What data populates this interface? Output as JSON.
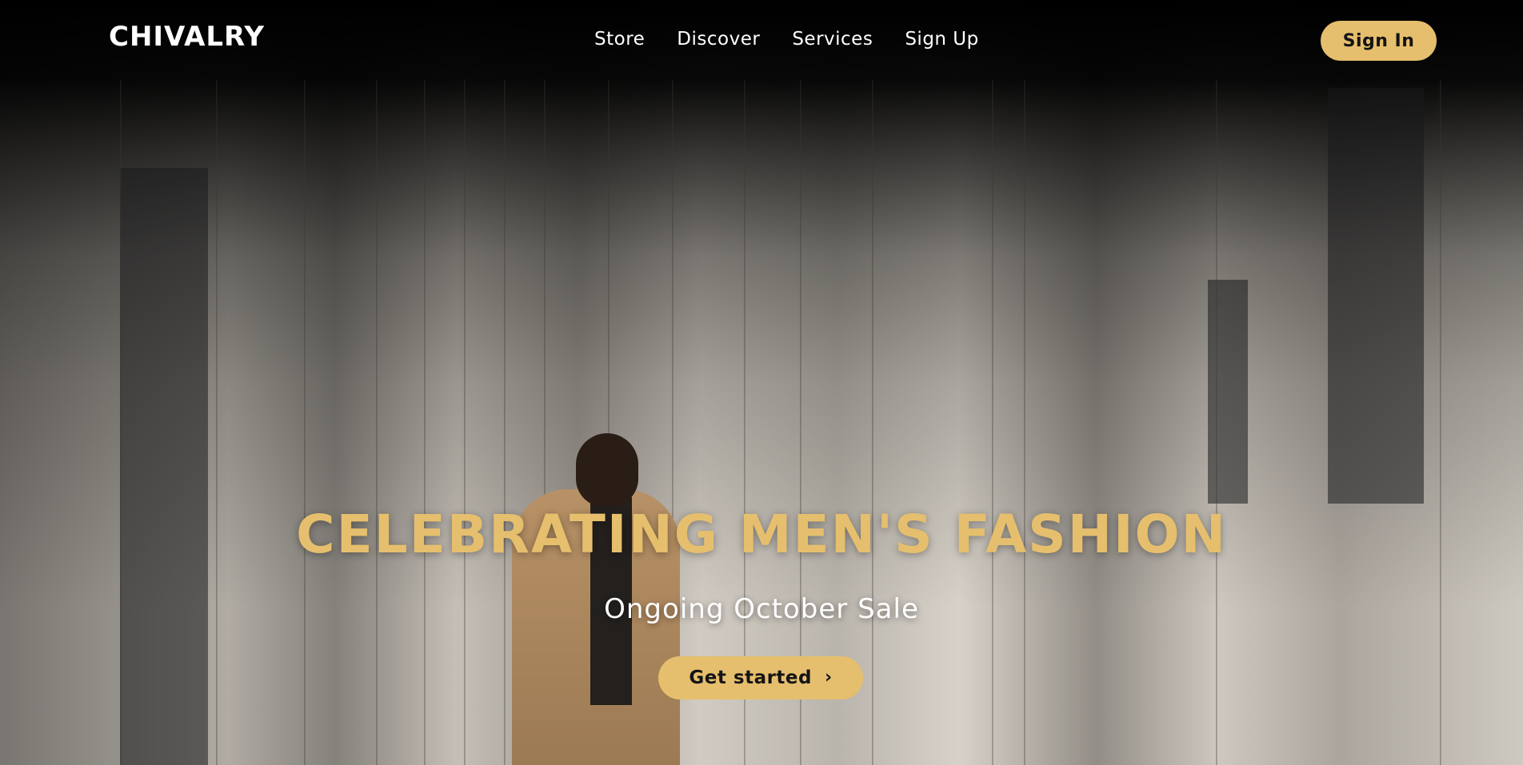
{
  "brand": {
    "logo_text": "CHIVALRY"
  },
  "nav": {
    "items": [
      {
        "label": "Store"
      },
      {
        "label": "Discover"
      },
      {
        "label": "Services"
      },
      {
        "label": "Sign Up"
      }
    ],
    "signin_label": "Sign In"
  },
  "hero": {
    "headline": "CELEBRATING MEN'S FASHION",
    "subheadline": "Ongoing October Sale",
    "cta_label": "Get started",
    "cta_icon": "chevron-right-icon"
  },
  "colors": {
    "accent": "#e6bf6e",
    "nav_background": "#000000",
    "text_light": "#ffffff",
    "text_dark": "#141414"
  }
}
